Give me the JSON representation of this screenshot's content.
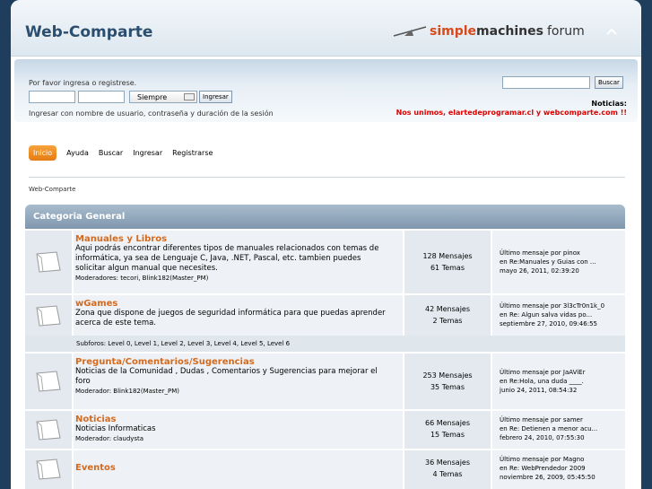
{
  "header": {
    "forum_title": "Web-Comparte",
    "logo_simple": "simple",
    "logo_machines": "machines",
    "logo_forum": "forum"
  },
  "userbar": {
    "login_message": "Por favor ingresa o registrese.",
    "session_select": "Siempre",
    "login_button": "Ingresar",
    "login_hint": "Ingresar con nombre de usuario, contraseña y duración de la sesión",
    "search_button": "Buscar",
    "news_title": "Noticias:",
    "news_text": "Nos unimos, elartedeprogramar.cl y webcomparte.com !!"
  },
  "menu": {
    "items": [
      "Inicio",
      "Ayuda",
      "Buscar",
      "Ingresar",
      "Registrarse"
    ]
  },
  "breadcrumb": "Web-Comparte",
  "category": {
    "title": "Categoria General",
    "boards": [
      {
        "name": "Manuales y Libros",
        "description": "Aqui podrás encontrar diferentes tipos de manuales relacionados con temas de informática, ya sea de Lenguaje C, Java, .NET, Pascal, etc. tambien puedes solicitar algun manual que necesites.",
        "moderators": "Moderadores: tecori, Blink182(Master_PM)",
        "posts": "128 Mensajes",
        "topics": "61 Temas",
        "last_by": "Último mensaje por pinox",
        "last_in": "en Re:Manuales y Guias con ...",
        "last_date": "mayo 26, 2011, 02:39:20"
      },
      {
        "name": "wGames",
        "description": "Zona que dispone de juegos de seguridad informática para que puedas aprender acerca de este tema.",
        "moderators": "",
        "posts": "42 Mensajes",
        "topics": "2 Temas",
        "last_by": "Último mensaje por 3l3cTr0n1k_0",
        "last_in": "en Re: Algun salva vidas po...",
        "last_date": "septiembre 27, 2010, 09:46:55"
      },
      {
        "name": "Pregunta/Comentarios/Sugerencias",
        "description": "Noticias de la Comunidad , Dudas , Comentarios y Sugerencias para mejorar el foro",
        "moderators": "Moderador: Blink182(Master_PM)",
        "posts": "253 Mensajes",
        "topics": "35 Temas",
        "last_by": "Último mensaje por JaAViEr",
        "last_in": "en Re:Hola, una duda ____.",
        "last_date": "junio 24, 2011, 08:54:32"
      },
      {
        "name": "Noticias",
        "description": "Noticias Informaticas",
        "moderators": "Moderador: claudysta",
        "posts": "66 Mensajes",
        "topics": "15 Temas",
        "last_by": "Último mensaje por samer",
        "last_in": "en Re: Detienen a menor acu...",
        "last_date": "febrero 24, 2010, 07:55:30"
      },
      {
        "name": "Eventos",
        "description": "",
        "moderators": "",
        "posts": "36 Mensajes",
        "topics": "4 Temas",
        "last_by": "Último mensaje por Magno",
        "last_in": "en Re: WebPrendedor 2009",
        "last_date": "noviembre 26, 2009, 05:45:50"
      }
    ],
    "subforums": "Subforos: Level 0, Level 1, Level 2, Level 3, Level 4, Level 5, Level 6"
  }
}
